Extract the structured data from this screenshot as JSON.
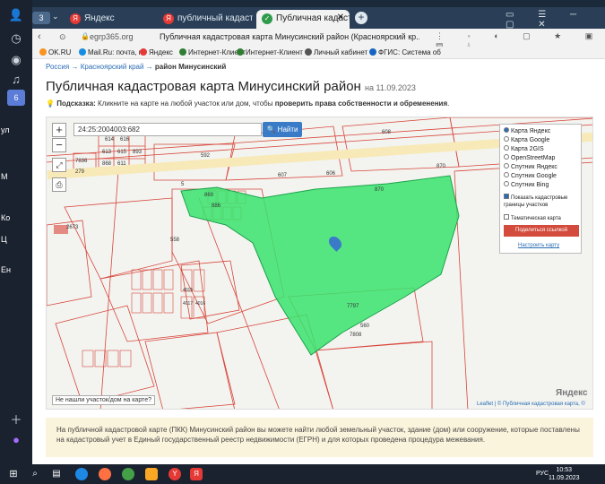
{
  "browser": {
    "tab_count": "3",
    "tabs": [
      {
        "label": "Яндекс",
        "icon_color": "#e53935"
      },
      {
        "label": "публичный кадастровый",
        "icon_color": "#e53935"
      },
      {
        "label": "Публичная кадастровая",
        "icon_color": "#2e9b4b",
        "active": true
      }
    ],
    "address_host": "egrp365.org",
    "address_title": "Публичная кадастровая карта Минусинский район (Красноярский кр...",
    "bookmarks": [
      "OK.RU",
      "Mail.Ru: почта, по",
      "Яндекс",
      "Интернет-Клиент",
      "Интернет-Клиент",
      "Личный кабинет",
      "ФГИС: Система об"
    ]
  },
  "sidebar": {
    "badge": "6",
    "labels": [
      "ул",
      "М",
      "Ко",
      "Ц",
      "Ен"
    ]
  },
  "page": {
    "breadcrumb": {
      "country": "Россия",
      "region": "Красноярский край",
      "current": "район Минусинский",
      "sep": "→"
    },
    "title": "Публичная кадастровая карта Минусинский район",
    "date": "на 11.09.2023",
    "hint_label": "Подсказка:",
    "hint_text": "Кликните на карте на любой участок или дом, чтобы",
    "hint_bold": "проверить права собственности и обременения",
    "search_value": "24:25:2004003:682",
    "find_button": "Найти",
    "layers": {
      "options": [
        "Карта Яндекс",
        "Карта Google",
        "Карта 2GIS",
        "OpenStreetMap",
        "Спутник Яндекс",
        "Спутник Google",
        "Спутник Bing"
      ],
      "show_borders": "Показать кадастровые границы участков",
      "thematic": "Тематическая карта",
      "share": "Поделиться ссылкой",
      "setup": "Настроить карту"
    },
    "not_found": "Не нашли участок/дом на карте?",
    "yandex": "Яндекс",
    "credits": "Leaflet | © Публичная кадастровая карта, ©",
    "info": "На публичной кадастровой карте (ПКК) Минусинский район вы можете найти любой земельный участок, здание (дом) или сооружение, которые поставлены на кадастровый учет в Единый государственный реестр недвижимости (ЕГРН) и для которых проведена процедура межевания."
  },
  "map_labels": [
    "614",
    "616",
    "613",
    "615",
    "893",
    "868",
    "611",
    "7836",
    "279",
    "592",
    "608",
    "607",
    "606",
    "870",
    "870",
    "869",
    "886",
    "558",
    "2673",
    "5",
    "560",
    "7808",
    "7797",
    "4015",
    "4017",
    "4016"
  ],
  "taskbar": {
    "lang": "РУС",
    "time": "10:53",
    "date": "11.09.2023"
  }
}
